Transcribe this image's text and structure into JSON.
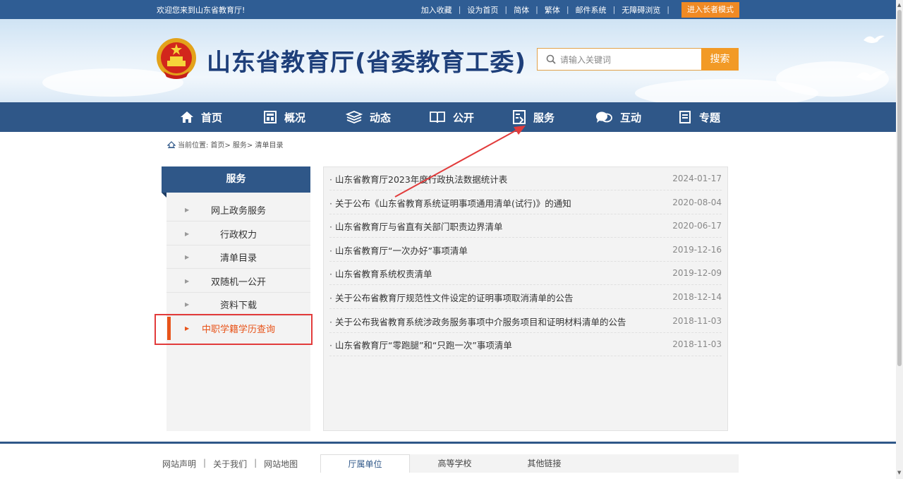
{
  "topbar": {
    "welcome": "欢迎您来到山东省教育厅!",
    "links": [
      "加入收藏",
      "设为首页",
      "简体",
      "繁体",
      "邮件系统",
      "无障碍浏览"
    ],
    "elder_mode": "进入长者模式"
  },
  "header": {
    "title": "山东省教育厅(省委教育工委)",
    "search_placeholder": "请输入关键词",
    "search_button": "搜索"
  },
  "nav": [
    {
      "label": "首页",
      "icon": "home-icon"
    },
    {
      "label": "概况",
      "icon": "overview-icon"
    },
    {
      "label": "动态",
      "icon": "news-icon"
    },
    {
      "label": "公开",
      "icon": "book-icon"
    },
    {
      "label": "服务",
      "icon": "service-icon"
    },
    {
      "label": "互动",
      "icon": "chat-icon"
    },
    {
      "label": "专题",
      "icon": "topic-icon"
    }
  ],
  "breadcrumb": {
    "prefix": "当前位置:",
    "path": "首页> 服务> 清单目录"
  },
  "sidebar": {
    "title": "服务",
    "items": [
      {
        "label": "网上政务服务",
        "active": false
      },
      {
        "label": "行政权力",
        "active": false
      },
      {
        "label": "清单目录",
        "active": false
      },
      {
        "label": "双随机一公开",
        "active": false
      },
      {
        "label": "资料下载",
        "active": false
      },
      {
        "label": "中职学籍学历查询",
        "active": true
      }
    ]
  },
  "list": [
    {
      "title": "山东省教育厅2023年度行政执法数据统计表",
      "date": "2024-01-17"
    },
    {
      "title": "关于公布《山东省教育系统证明事项通用清单(试行)》的通知",
      "date": "2020-08-04"
    },
    {
      "title": "山东省教育厅与省直有关部门职责边界清单",
      "date": "2020-06-17"
    },
    {
      "title": "山东省教育厅“一次办好”事项清单",
      "date": "2019-12-16"
    },
    {
      "title": "山东省教育系统权责清单",
      "date": "2019-12-09"
    },
    {
      "title": "关于公布省教育厅规范性文件设定的证明事项取消清单的公告",
      "date": "2018-12-14"
    },
    {
      "title": "关于公布我省教育系统涉政务服务事项中介服务项目和证明材料清单的公告",
      "date": "2018-11-03"
    },
    {
      "title": "山东省教育厅“零跑腿”和“只跑一次”事项清单",
      "date": "2018-11-03"
    }
  ],
  "footer": {
    "links": [
      "网站声明",
      "关于我们",
      "网站地图"
    ],
    "tabs": [
      {
        "label": "厅属单位",
        "active": true
      },
      {
        "label": "高等学校",
        "active": false
      },
      {
        "label": "其他链接",
        "active": false
      }
    ]
  },
  "colors": {
    "brand": "#2f5788",
    "accent": "#f29a26",
    "active": "#e8541a",
    "annotation": "#e23b3b"
  }
}
